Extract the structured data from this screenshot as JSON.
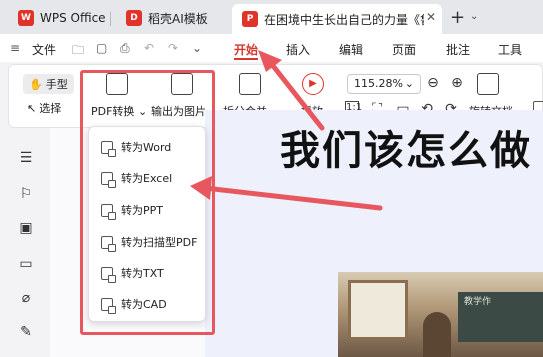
{
  "tabs": [
    {
      "label": "WPS Office"
    },
    {
      "label": "稻壳AI模板"
    },
    {
      "label": "在困境中生长出自己的力量《鲁"
    }
  ],
  "tabbar": {
    "new_tab": "+",
    "menu": "⌄"
  },
  "quick_access": {
    "file": "文件"
  },
  "menu": {
    "items": [
      "开始",
      "插入",
      "编辑",
      "页面",
      "批注",
      "工具"
    ]
  },
  "ribbon": {
    "hand": "手型",
    "select": "选择",
    "pdf_convert": "PDF转换",
    "export_image": "输出为图片",
    "split_merge": "拆分合并",
    "play": "播放",
    "zoom": "115.28%",
    "rotate": "旋转文档"
  },
  "dropdown": {
    "items": [
      "转为Word",
      "转为Excel",
      "转为PPT",
      "转为扫描型PDF",
      "转为TXT",
      "转为CAD"
    ]
  },
  "document": {
    "heading": "我们该怎么做",
    "board_text": "教学作"
  },
  "colors": {
    "accent": "#d23a2e",
    "highlight": "#e8575e"
  }
}
